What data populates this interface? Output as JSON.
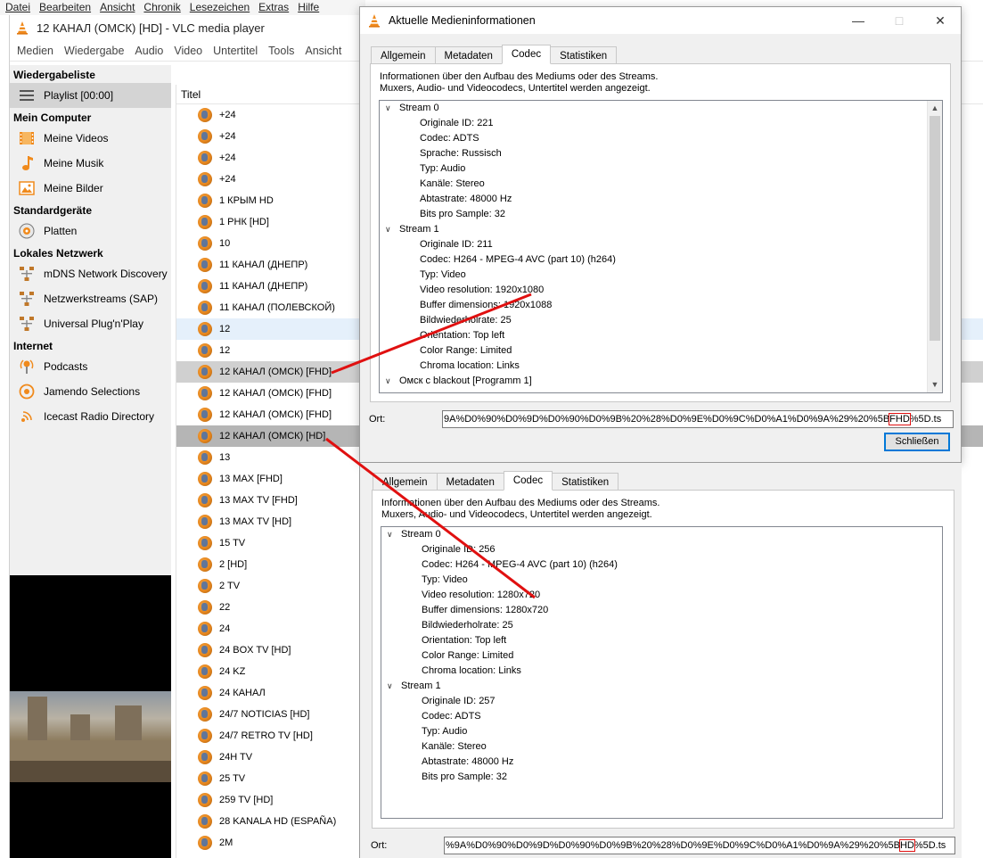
{
  "os_menu": [
    "Datei",
    "Bearbeiten",
    "Ansicht",
    "Chronik",
    "Lesezeichen",
    "Extras",
    "Hilfe"
  ],
  "vlc": {
    "title": "12 КАНАЛ (ОМСК) [HD] - VLC media player",
    "menu": [
      "Medien",
      "Wiedergabe",
      "Audio",
      "Video",
      "Untertitel",
      "Tools",
      "Ansicht"
    ]
  },
  "sidebar": {
    "playlist_header": "Wiedergabeliste",
    "playlist_item": "Playlist [00:00]",
    "computer_header": "Mein Computer",
    "videos": "Meine Videos",
    "music": "Meine Musik",
    "pictures": "Meine Bilder",
    "devices_header": "Standardgeräte",
    "discs": "Platten",
    "network_header": "Lokales Netzwerk",
    "mdns": "mDNS Network Discovery",
    "sap": "Netzwerkstreams (SAP)",
    "upnp": "Universal Plug'n'Play",
    "internet_header": "Internet",
    "podcasts": "Podcasts",
    "jamendo": "Jamendo Selections",
    "icecast": "Icecast Radio Directory"
  },
  "playlist": {
    "column_title": "Titel",
    "items": [
      "+24",
      "+24",
      "+24",
      "+24",
      "1 КРЫМ HD",
      "1 РНК [HD]",
      "10",
      "11 КАНАЛ (ДНЕПР)",
      "11 КАНАЛ (ДНЕПР)",
      "11 КАНАЛ (ПОЛЕВСКОЙ)",
      "12",
      "12",
      "12 КАНАЛ (ОМСК) [FHD]",
      "12 КАНАЛ (ОМСК) [FHD]",
      "12 КАНАЛ (ОМСК) [FHD]",
      "12 КАНАЛ (ОМСК) [HD]",
      "13",
      "13 MAX [FHD]",
      "13 MAX TV [FHD]",
      "13 MAX TV [HD]",
      "15 TV",
      "2 [HD]",
      "2 TV",
      "22",
      "24",
      "24 BOX TV [HD]",
      "24 KZ",
      "24 КАНАЛ",
      "24/7 NOTICIAS [HD]",
      "24/7 RETRO TV [HD]",
      "24H TV",
      "25 TV",
      "259 TV [HD]",
      "28 KANALA HD (ESPAÑA)",
      "2M"
    ]
  },
  "dialog": {
    "title": "Aktuelle Medieninformationen",
    "tabs": [
      "Allgemein",
      "Metadaten",
      "Codec",
      "Statistiken"
    ],
    "description_line1": "Informationen über den Aufbau des Mediums oder des Streams.",
    "description_line2": "Muxers, Audio- und Videocodecs, Untertitel werden angezeigt.",
    "tree": [
      {
        "level": 0,
        "text": "Stream 0"
      },
      {
        "level": 1,
        "text": "Originale ID: 221"
      },
      {
        "level": 1,
        "text": "Codec: ADTS"
      },
      {
        "level": 1,
        "text": "Sprache: Russisch"
      },
      {
        "level": 1,
        "text": "Typ: Audio"
      },
      {
        "level": 1,
        "text": "Kanäle: Stereo"
      },
      {
        "level": 1,
        "text": "Abtastrate: 48000 Hz"
      },
      {
        "level": 1,
        "text": "Bits pro Sample: 32"
      },
      {
        "level": 0,
        "text": "Stream 1"
      },
      {
        "level": 1,
        "text": "Originale ID: 211"
      },
      {
        "level": 1,
        "text": "Codec: H264 - MPEG-4 AVC (part 10) (h264)"
      },
      {
        "level": 1,
        "text": "Typ: Video"
      },
      {
        "level": 1,
        "text": "Video resolution: 1920x1080"
      },
      {
        "level": 1,
        "text": "Buffer dimensions: 1920x1088"
      },
      {
        "level": 1,
        "text": "Bildwiederholrate: 25"
      },
      {
        "level": 1,
        "text": "Orientation: Top left"
      },
      {
        "level": 1,
        "text": "Color Range: Limited"
      },
      {
        "level": 1,
        "text": "Chroma location: Links"
      },
      {
        "level": 0,
        "text": "Омск с blackout [Programm 1]"
      }
    ],
    "ort_label": "Ort:",
    "ort_before": "9A%D0%90%D0%9D%D0%90%D0%9B%20%28%D0%9E%D0%9C%D0%A1%D0%9A%29%20%5B",
    "ort_highlight": "FHD",
    "ort_after": "%5D.ts",
    "close_button": "Schließen"
  },
  "dialog2": {
    "tabs": [
      "Allgemein",
      "Metadaten",
      "Codec",
      "Statistiken"
    ],
    "description_line1": "Informationen über den Aufbau des Mediums oder des Streams.",
    "description_line2": "Muxers, Audio- und Videocodecs, Untertitel werden angezeigt.",
    "tree": [
      {
        "level": 0,
        "text": "Stream 0"
      },
      {
        "level": 1,
        "text": "Originale ID: 256"
      },
      {
        "level": 1,
        "text": "Codec: H264 - MPEG-4 AVC (part 10) (h264)"
      },
      {
        "level": 1,
        "text": "Typ: Video"
      },
      {
        "level": 1,
        "text": "Video resolution: 1280x720"
      },
      {
        "level": 1,
        "text": "Buffer dimensions: 1280x720"
      },
      {
        "level": 1,
        "text": "Bildwiederholrate: 25"
      },
      {
        "level": 1,
        "text": "Orientation: Top left"
      },
      {
        "level": 1,
        "text": "Color Range: Limited"
      },
      {
        "level": 1,
        "text": "Chroma location: Links"
      },
      {
        "level": 0,
        "text": "Stream 1"
      },
      {
        "level": 1,
        "text": "Originale ID: 257"
      },
      {
        "level": 1,
        "text": "Codec: ADTS"
      },
      {
        "level": 1,
        "text": "Typ: Audio"
      },
      {
        "level": 1,
        "text": "Kanäle: Stereo"
      },
      {
        "level": 1,
        "text": "Abtastrate: 48000 Hz"
      },
      {
        "level": 1,
        "text": "Bits pro Sample: 32"
      }
    ],
    "ort_label": "Ort:",
    "ort_before": "%9A%D0%90%D0%9D%D0%90%D0%9B%20%28%D0%9E%D0%9C%D0%A1%D0%9A%29%20%5B",
    "ort_highlight": "HD",
    "ort_after": "%5D.ts"
  },
  "colors": {
    "accent": "#0078d7",
    "annotation_red": "#e01010",
    "vlc_orange": "#f08a1c"
  }
}
